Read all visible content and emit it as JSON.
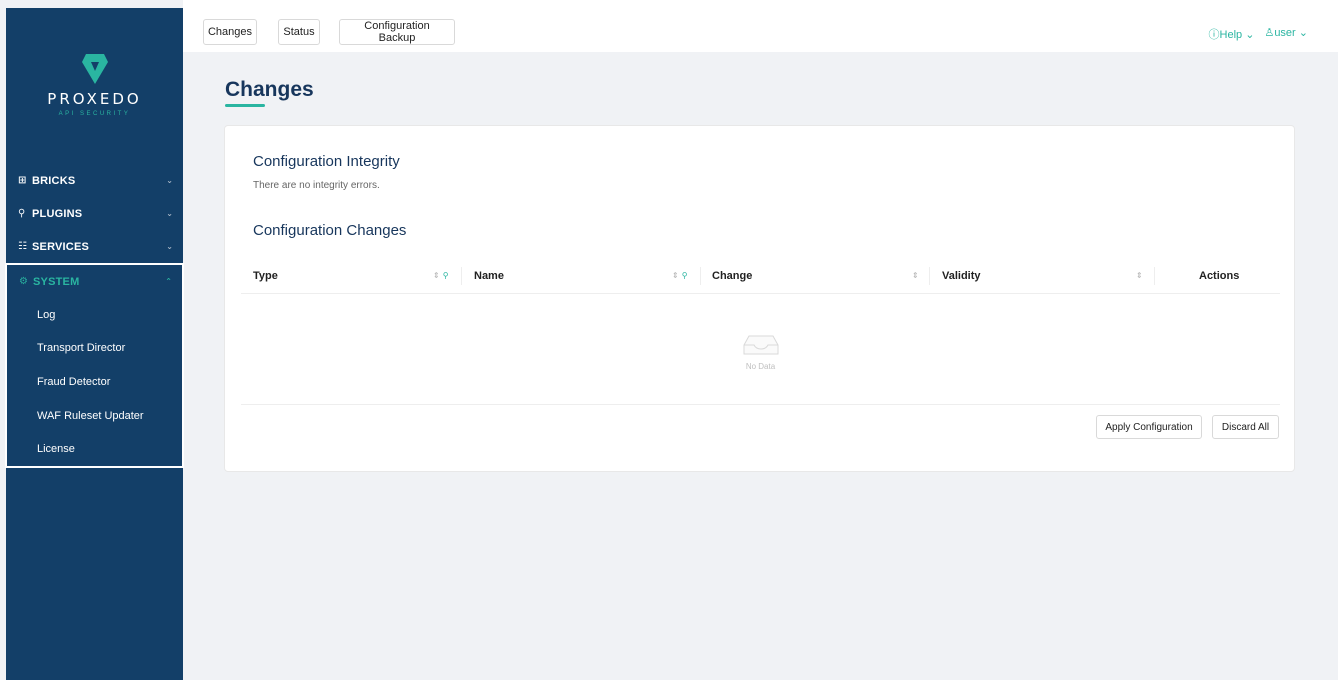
{
  "brand": {
    "name": "PROXEDO",
    "tagline": "API SECURITY"
  },
  "sidebar": {
    "groups": [
      {
        "icon": "bricks-icon",
        "label": "BRICKS"
      },
      {
        "icon": "plugins-icon",
        "label": "PLUGINS"
      },
      {
        "icon": "services-icon",
        "label": "SERVICES"
      }
    ],
    "system": {
      "icon": "gear-icon",
      "label": "SYSTEM",
      "items": [
        "Log",
        "Transport Director",
        "Fraud Detector",
        "WAF Ruleset Updater",
        "License"
      ]
    }
  },
  "topbar": {
    "tabs": [
      "Changes",
      "Status",
      "Configuration Backup"
    ],
    "help": "Help",
    "user": "user"
  },
  "page": {
    "title": "Changes",
    "integrity_title": "Configuration Integrity",
    "integrity_message": "There are no integrity errors.",
    "changes_title": "Configuration Changes",
    "columns": [
      "Type",
      "Name",
      "Change",
      "Validity",
      "Actions"
    ],
    "empty_text": "No Data",
    "apply_button": "Apply Configuration",
    "discard_button": "Discard All"
  },
  "colors": {
    "sidebar": "#133f68",
    "accent": "#2ab5a1",
    "title": "#17365c"
  }
}
